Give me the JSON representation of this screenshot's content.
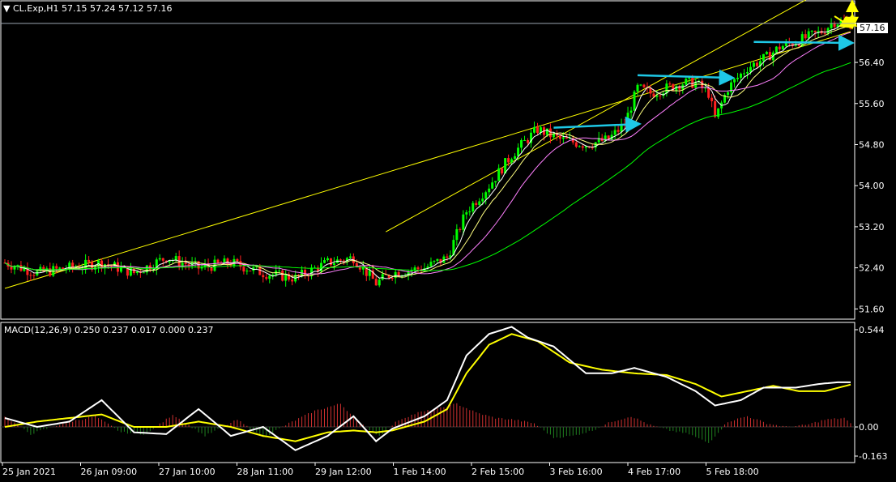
{
  "header": {
    "symbol": "CL.Exp,H1",
    "ohlc": "57.15 57.24 57.12 57.16",
    "current_price": "57.16",
    "macd_label": "MACD(12,26,9) 0.250 0.237 0.017 0.000 0.237"
  },
  "colors": {
    "background": "#000000",
    "grid_border": "#ffffff",
    "bull_candle": "#00ff00",
    "bear_candle": "#ff2020",
    "channel": "#ffff00",
    "ma_fast": "#ffffff",
    "ma_mid": "#ffff80",
    "ma_slow": "#ff80ff",
    "ma_long": "#00ff00",
    "arrow_cyan": "#1ec8e6",
    "arrow_yellow": "#ffff00",
    "macd_line": "#ffffff",
    "signal_line": "#ffff00",
    "hist_up": "#d03030",
    "hist_down": "#208020"
  },
  "chart_data": [
    {
      "type": "candlestick",
      "title": "CL.Exp,H1",
      "x_tick_labels": [
        "25 Jan 2021",
        "26 Jan 09:00",
        "27 Jan 10:00",
        "28 Jan 11:00",
        "29 Jan 12:00",
        "1 Feb 14:00",
        "2 Feb 15:00",
        "3 Feb 16:00",
        "4 Feb 17:00",
        "5 Feb 18:00"
      ],
      "y_tick_labels": [
        "57.16",
        "56.40",
        "55.60",
        "54.80",
        "54.00",
        "53.20",
        "52.40",
        "51.60"
      ],
      "ylim": [
        51.4,
        57.6
      ],
      "current_price": 57.16,
      "price_path_keypoints": [
        [
          0,
          52.5
        ],
        [
          10,
          52.3
        ],
        [
          20,
          52.4
        ],
        [
          30,
          52.5
        ],
        [
          40,
          52.3
        ],
        [
          50,
          52.6
        ],
        [
          60,
          52.4
        ],
        [
          70,
          52.5
        ],
        [
          80,
          52.3
        ],
        [
          90,
          52.2
        ],
        [
          100,
          52.5
        ],
        [
          108,
          52.6
        ],
        [
          115,
          52.1
        ],
        [
          120,
          52.3
        ],
        [
          130,
          52.4
        ],
        [
          137,
          52.6
        ],
        [
          143,
          53.5
        ],
        [
          150,
          54.0
        ],
        [
          157,
          54.6
        ],
        [
          165,
          55.1
        ],
        [
          172,
          54.9
        ],
        [
          180,
          54.8
        ],
        [
          187,
          54.9
        ],
        [
          192,
          55.2
        ],
        [
          196,
          55.9
        ],
        [
          200,
          55.8
        ],
        [
          205,
          55.9
        ],
        [
          210,
          56.0
        ],
        [
          214,
          56.0
        ],
        [
          218,
          55.8
        ],
        [
          220,
          55.3
        ],
        [
          224,
          55.9
        ],
        [
          230,
          56.3
        ],
        [
          236,
          56.5
        ],
        [
          240,
          56.7
        ],
        [
          245,
          56.8
        ],
        [
          249,
          56.9
        ],
        [
          253,
          57.0
        ],
        [
          257,
          57.2
        ],
        [
          262,
          57.16
        ]
      ],
      "channel": {
        "lower_line": [
          [
            0,
            52.0
          ],
          [
            262,
            57.0
          ]
        ],
        "upper_line": [
          [
            118,
            53.1
          ],
          [
            262,
            58.1
          ]
        ]
      },
      "horizontal_arrows": [
        {
          "from": [
            170,
            55.13
          ],
          "to": [
            196,
            55.2
          ]
        },
        {
          "from": [
            196,
            56.15
          ],
          "to": [
            225,
            56.1
          ]
        },
        {
          "from": [
            232,
            56.8
          ],
          "to": [
            262,
            56.78
          ]
        }
      ],
      "projection_arrows": [
        [
          [
            257,
            57.3
          ],
          [
            262,
            57.1
          ],
          [
            265,
            57.3
          ],
          [
            270,
            57.1
          ],
          [
            275,
            57.6
          ]
        ]
      ]
    },
    {
      "type": "macd",
      "title": "MACD(12,26,9)",
      "params": [
        12,
        26,
        9
      ],
      "values": {
        "macd": 0.25,
        "signal": 0.237,
        "histogram": 0.017,
        "zero": 0.0,
        "last": 0.237
      },
      "y_tick_labels": [
        "0.544",
        "0.00",
        "-0.163"
      ],
      "ylim": [
        -0.163,
        0.544
      ],
      "macd_keypoints": [
        [
          0,
          0.05
        ],
        [
          10,
          0.0
        ],
        [
          20,
          0.03
        ],
        [
          30,
          0.15
        ],
        [
          40,
          -0.03
        ],
        [
          50,
          -0.04
        ],
        [
          60,
          0.1
        ],
        [
          70,
          -0.05
        ],
        [
          80,
          0.0
        ],
        [
          90,
          -0.13
        ],
        [
          100,
          -0.05
        ],
        [
          108,
          0.06
        ],
        [
          115,
          -0.08
        ],
        [
          120,
          -0.01
        ],
        [
          130,
          0.06
        ],
        [
          137,
          0.15
        ],
        [
          143,
          0.4
        ],
        [
          150,
          0.52
        ],
        [
          157,
          0.56
        ],
        [
          162,
          0.5
        ],
        [
          170,
          0.45
        ],
        [
          180,
          0.3
        ],
        [
          188,
          0.3
        ],
        [
          195,
          0.33
        ],
        [
          205,
          0.28
        ],
        [
          214,
          0.2
        ],
        [
          220,
          0.12
        ],
        [
          228,
          0.15
        ],
        [
          235,
          0.22
        ],
        [
          245,
          0.22
        ],
        [
          252,
          0.24
        ],
        [
          258,
          0.25
        ],
        [
          262,
          0.25
        ]
      ],
      "signal_keypoints": [
        [
          0,
          0.0
        ],
        [
          10,
          0.03
        ],
        [
          20,
          0.05
        ],
        [
          30,
          0.07
        ],
        [
          40,
          0.0
        ],
        [
          50,
          0.0
        ],
        [
          60,
          0.03
        ],
        [
          70,
          0.0
        ],
        [
          80,
          -0.05
        ],
        [
          90,
          -0.08
        ],
        [
          100,
          -0.03
        ],
        [
          108,
          -0.02
        ],
        [
          115,
          -0.03
        ],
        [
          120,
          -0.02
        ],
        [
          130,
          0.03
        ],
        [
          137,
          0.1
        ],
        [
          143,
          0.3
        ],
        [
          150,
          0.46
        ],
        [
          157,
          0.52
        ],
        [
          165,
          0.48
        ],
        [
          175,
          0.36
        ],
        [
          185,
          0.32
        ],
        [
          195,
          0.3
        ],
        [
          205,
          0.29
        ],
        [
          214,
          0.24
        ],
        [
          222,
          0.17
        ],
        [
          230,
          0.2
        ],
        [
          238,
          0.23
        ],
        [
          246,
          0.2
        ],
        [
          254,
          0.2
        ],
        [
          262,
          0.237
        ]
      ],
      "histogram_keypoints": [
        [
          0,
          0.06
        ],
        [
          8,
          -0.04
        ],
        [
          18,
          0.02
        ],
        [
          28,
          0.06
        ],
        [
          36,
          -0.03
        ],
        [
          44,
          -0.04
        ],
        [
          52,
          0.07
        ],
        [
          62,
          -0.05
        ],
        [
          72,
          0.04
        ],
        [
          80,
          -0.06
        ],
        [
          88,
          0.02
        ],
        [
          96,
          0.09
        ],
        [
          104,
          0.13
        ],
        [
          110,
          0.02
        ],
        [
          116,
          -0.05
        ],
        [
          122,
          0.04
        ],
        [
          128,
          0.08
        ],
        [
          134,
          0.1
        ],
        [
          140,
          0.13
        ],
        [
          146,
          0.08
        ],
        [
          152,
          0.05
        ],
        [
          158,
          0.04
        ],
        [
          164,
          0.02
        ],
        [
          170,
          -0.06
        ],
        [
          176,
          -0.05
        ],
        [
          182,
          -0.02
        ],
        [
          188,
          0.03
        ],
        [
          194,
          0.06
        ],
        [
          200,
          0.01
        ],
        [
          206,
          -0.02
        ],
        [
          212,
          -0.04
        ],
        [
          218,
          -0.09
        ],
        [
          224,
          0.03
        ],
        [
          230,
          0.06
        ],
        [
          236,
          0.02
        ],
        [
          242,
          0.0
        ],
        [
          248,
          0.01
        ],
        [
          254,
          0.04
        ],
        [
          260,
          0.05
        ],
        [
          262,
          0.017
        ]
      ]
    }
  ]
}
